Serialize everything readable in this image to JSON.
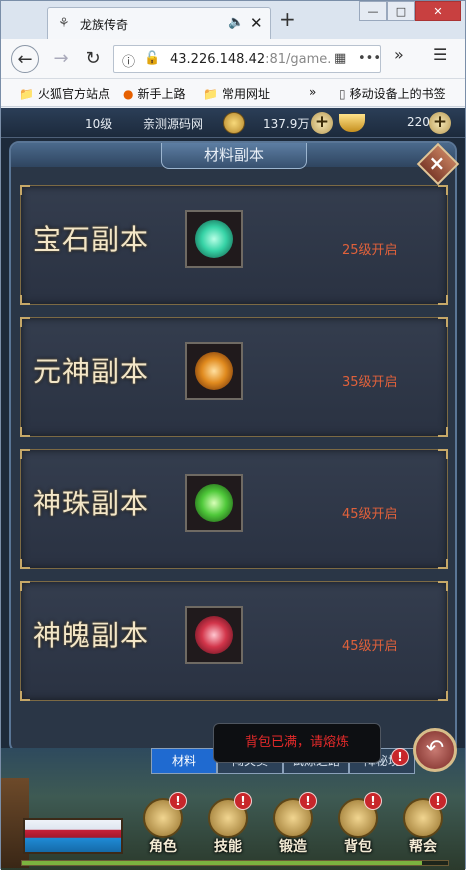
{
  "browser": {
    "tab_title": "龙族传奇",
    "url_main": "43.226.148.42",
    "url_rest": ":81/game.",
    "bookmarks": [
      "火狐官方站点",
      "新手上路",
      "常用网址",
      "移动设备上的书签"
    ]
  },
  "hud": {
    "level": "10级",
    "server_name": "亲测源码网",
    "gold": "137.9万",
    "ingot": "220"
  },
  "panel": {
    "title": "材料副本",
    "close_label": "×"
  },
  "dungeons": [
    {
      "name": "宝石副本",
      "requirement": "25级开启",
      "gem_color": "#36d3a6"
    },
    {
      "name": "元神副本",
      "requirement": "35级开启",
      "gem_color": "#e08a1e"
    },
    {
      "name": "神珠副本",
      "requirement": "45级开启",
      "gem_color": "#4fc93a"
    },
    {
      "name": "神魄副本",
      "requirement": "45级开启",
      "gem_color": "#d2354a"
    }
  ],
  "subtabs": [
    "材料",
    "闯关卖",
    "试炼之路",
    "降秘境"
  ],
  "toast": "背包已满，请熔炼",
  "menu": [
    {
      "label": "角色",
      "badge": "!"
    },
    {
      "label": "技能",
      "badge": "!"
    },
    {
      "label": "锻造",
      "badge": "!"
    },
    {
      "label": "背包",
      "badge": "!"
    },
    {
      "label": "帮会",
      "badge": "!"
    }
  ],
  "exp_progress": 0.94,
  "colors": {
    "requirement_text": "#e0613b",
    "toast_text": "#e32a2a",
    "active_tab": "#1f6ad0"
  }
}
